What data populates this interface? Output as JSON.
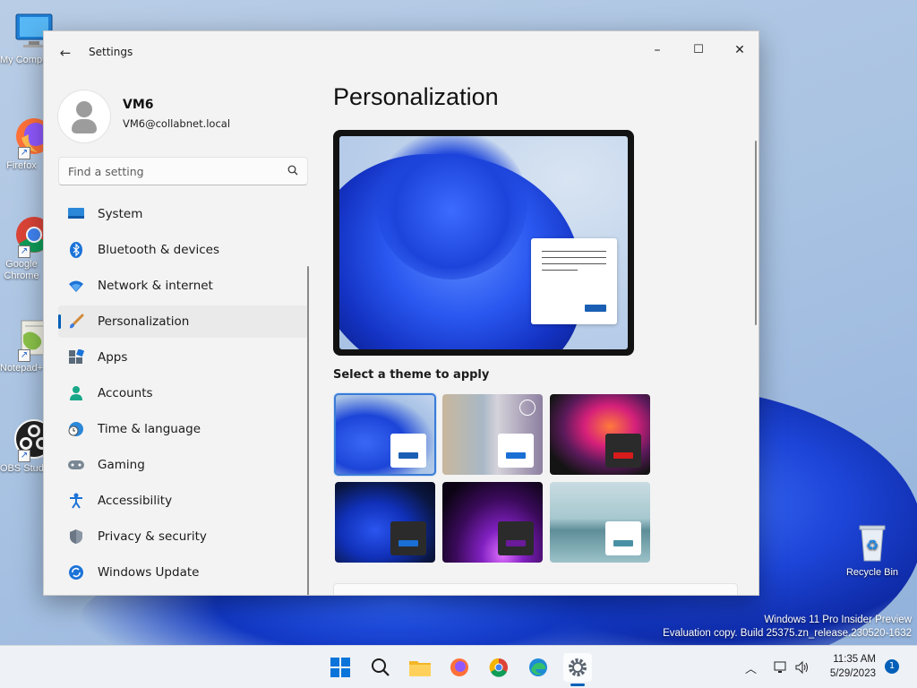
{
  "desktop": {
    "icons": [
      {
        "label": "My Computer",
        "icon": "monitor-icon"
      },
      {
        "label": "Firefox",
        "icon": "firefox-icon"
      },
      {
        "label": "Google Chrome",
        "icon": "chrome-icon"
      },
      {
        "label": "Notepad++",
        "icon": "notepad-plus-icon"
      },
      {
        "label": "OBS Studio",
        "icon": "obs-icon"
      },
      {
        "label": "Recycle Bin",
        "icon": "recycle-bin-icon"
      }
    ],
    "watermark_line1": "Windows 11 Pro Insider Preview",
    "watermark_line2": "Evaluation copy. Build 25375.zn_release.230520-1632"
  },
  "window": {
    "title": "Settings",
    "controls": {
      "minimize": "–",
      "maximize": "☐",
      "close": "✕"
    }
  },
  "profile": {
    "name": "VM6",
    "email": "VM6@collabnet.local"
  },
  "search": {
    "placeholder": "Find a setting"
  },
  "nav": {
    "items": [
      {
        "label": "System",
        "icon": "system-icon"
      },
      {
        "label": "Bluetooth & devices",
        "icon": "bluetooth-icon"
      },
      {
        "label": "Network & internet",
        "icon": "wifi-icon"
      },
      {
        "label": "Personalization",
        "icon": "brush-icon",
        "active": true
      },
      {
        "label": "Apps",
        "icon": "apps-icon"
      },
      {
        "label": "Accounts",
        "icon": "accounts-icon"
      },
      {
        "label": "Time & language",
        "icon": "globe-clock-icon"
      },
      {
        "label": "Gaming",
        "icon": "gamepad-icon"
      },
      {
        "label": "Accessibility",
        "icon": "accessibility-icon"
      },
      {
        "label": "Privacy & security",
        "icon": "shield-icon"
      },
      {
        "label": "Windows Update",
        "icon": "update-icon"
      }
    ]
  },
  "content": {
    "page_title": "Personalization",
    "theme_section_label": "Select a theme to apply",
    "themes": [
      {
        "name": "windows-light",
        "selected": true,
        "accent": "#1a5fb4"
      },
      {
        "name": "spotlight",
        "selected": false,
        "accent": "#1a6fd4"
      },
      {
        "name": "glow",
        "selected": false,
        "accent": "#d81b1b"
      },
      {
        "name": "windows-dark",
        "selected": false,
        "accent": "#1a6fd4"
      },
      {
        "name": "captured-motion",
        "selected": false,
        "accent": "#6a1a9a"
      },
      {
        "name": "flow",
        "selected": false,
        "accent": "#4a90a4"
      }
    ]
  },
  "taskbar": {
    "clock_time": "11:35 AM",
    "clock_date": "5/29/2023",
    "notification_count": "1"
  },
  "colors": {
    "accent": "#005fb8",
    "window_bg": "#f3f3f3"
  }
}
